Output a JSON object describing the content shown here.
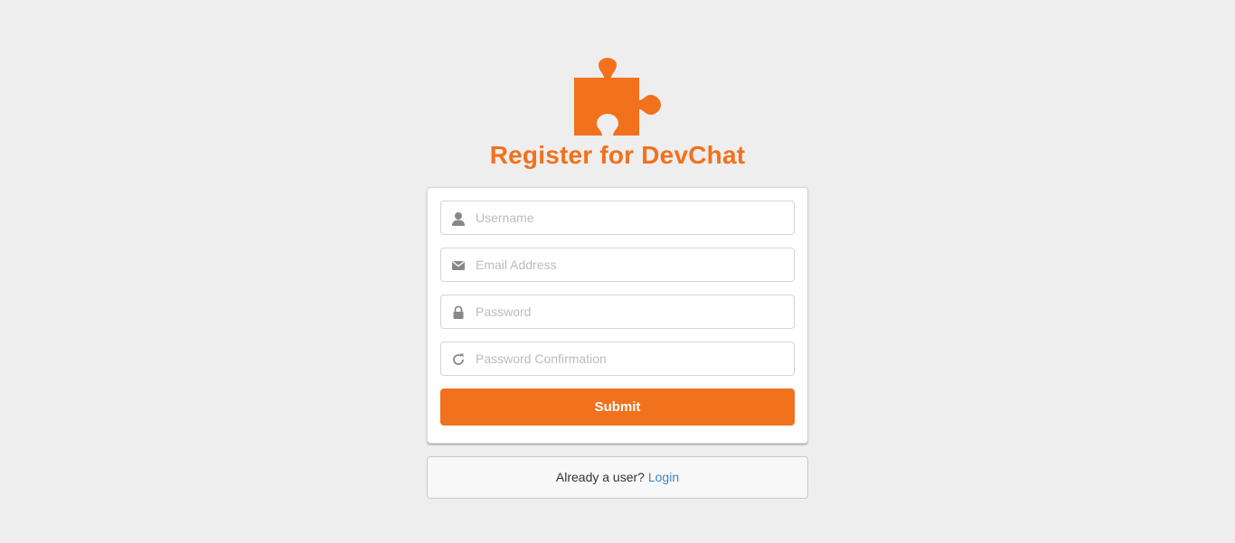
{
  "header": {
    "logo_icon": "puzzle-piece-icon",
    "title": "Register for DevChat",
    "accent_color": "#f2711c"
  },
  "form": {
    "username": {
      "icon": "user-icon",
      "placeholder": "Username",
      "value": ""
    },
    "email": {
      "icon": "envelope-icon",
      "placeholder": "Email Address",
      "value": ""
    },
    "password": {
      "icon": "lock-icon",
      "placeholder": "Password",
      "value": ""
    },
    "password_confirmation": {
      "icon": "redo-icon",
      "placeholder": "Password Confirmation",
      "value": ""
    },
    "submit_label": "Submit"
  },
  "footer": {
    "prompt": "Already a user?",
    "login_link": "Login"
  }
}
